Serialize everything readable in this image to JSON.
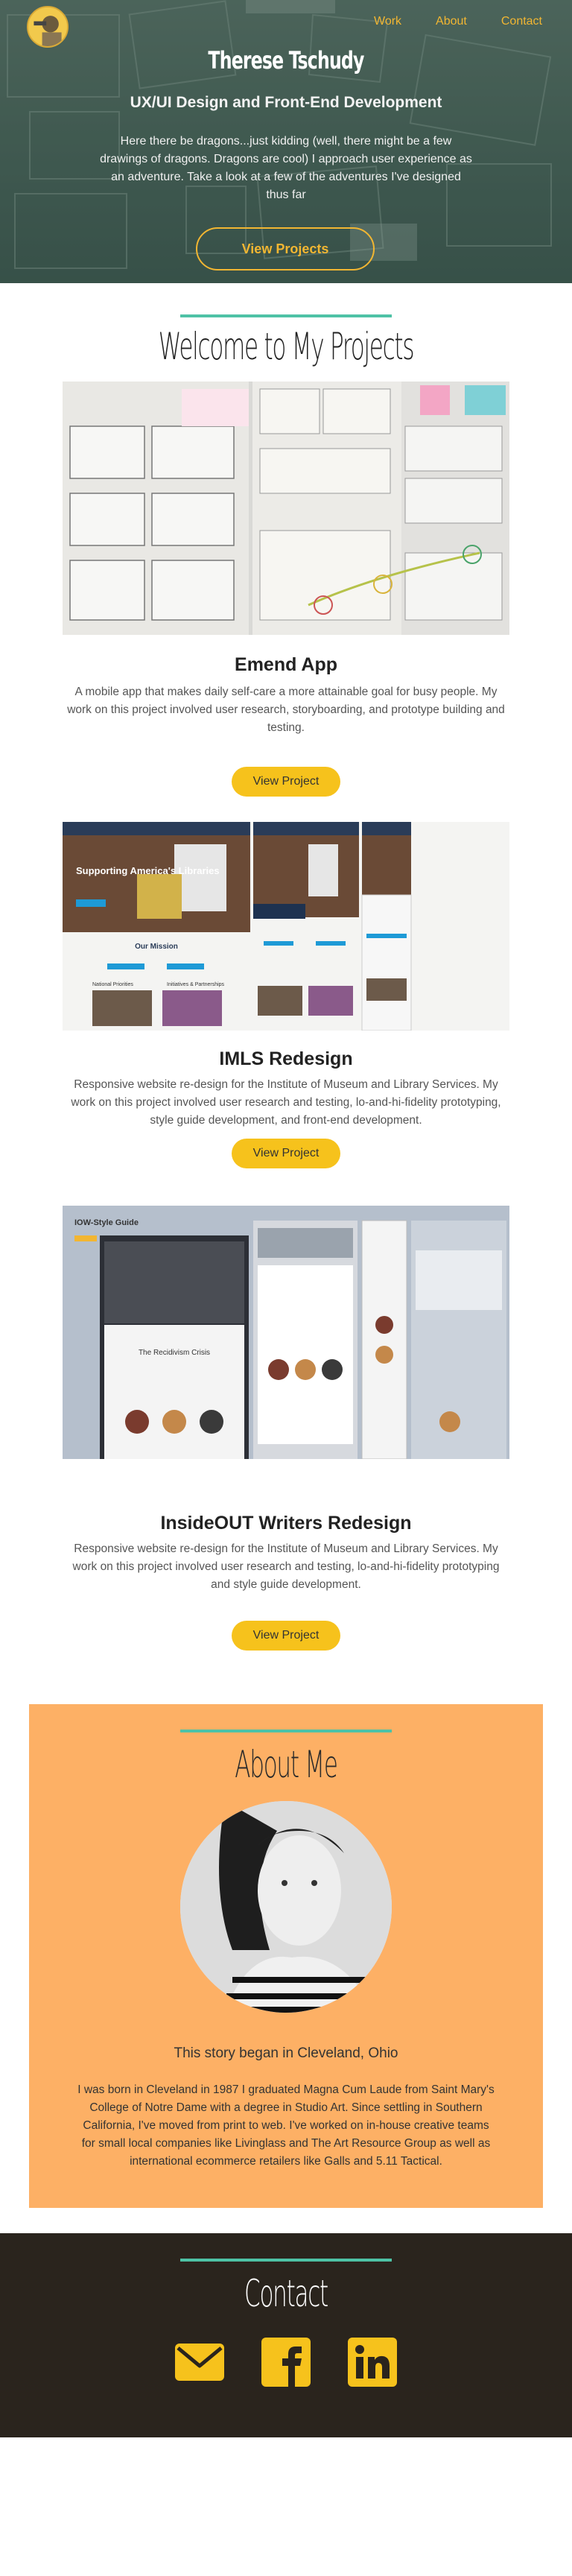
{
  "header": {
    "nav": [
      {
        "label": "Work"
      },
      {
        "label": "About"
      },
      {
        "label": "Contact"
      }
    ],
    "title": "Therese Tschudy",
    "subtitle": "UX/UI Design and Front-End Development",
    "description": "Here there be dragons...just kidding (well, there might be a few drawings of dragons. Dragons are cool) I approach user experience as an adventure. Take a look at a few of the adventures I've designed thus far",
    "cta_label": "View Projects"
  },
  "projects_section": {
    "title": "Welcome to My Projects",
    "projects": [
      {
        "name": "Emend App",
        "description": "A mobile app that makes daily self-care a more attainable goal for busy people. My work on this project involved user research, storyboarding, and prototype building and testing.",
        "button": "View Project"
      },
      {
        "name": "IMLS Redesign",
        "description": "Responsive website re-design for the Institute of Museum and Library Services. My work on this project involved user research and testing, lo-and-hi-fidelity prototyping, style guide development, and front-end development.",
        "button": "View Project",
        "mockup_text": {
          "headline": "Supporting America's Libraries",
          "section": "Our Mission",
          "col1": "National Priorities",
          "col2": "Initiatives & Partnerships"
        }
      },
      {
        "name": "InsideOUT Writers Redesign",
        "description": "Responsive website re-design for the Institute of Museum and Library Services. My work on this project involved user research and testing, lo-and-hi-fidelity prototyping and style guide development.",
        "button": "View Project",
        "mockup_text": {
          "guide": "IOW-Style Guide",
          "headline": "The Recidivism Crisis"
        }
      }
    ]
  },
  "about": {
    "title": "About Me",
    "tagline": "This story began in Cleveland, Ohio",
    "bio": "I was born in Cleveland in 1987 I graduated Magna Cum Laude from Saint Mary's College of Notre Dame with a degree in Studio Art. Since settling in Southern California, I've moved from print to web. I've worked on in-house creative teams for small local companies like Livinglass and The Art Resource Group as well as international ecommerce retailers like Galls and 5.11 Tactical."
  },
  "contact": {
    "title": "Contact",
    "icons": [
      "email-icon",
      "facebook-icon",
      "linkedin-icon"
    ]
  },
  "colors": {
    "accent_teal": "#4ec2a6",
    "accent_yellow": "#f6c21c",
    "nav_gold": "#f2b632",
    "about_bg": "#fdb065",
    "contact_bg": "#2a241d"
  }
}
